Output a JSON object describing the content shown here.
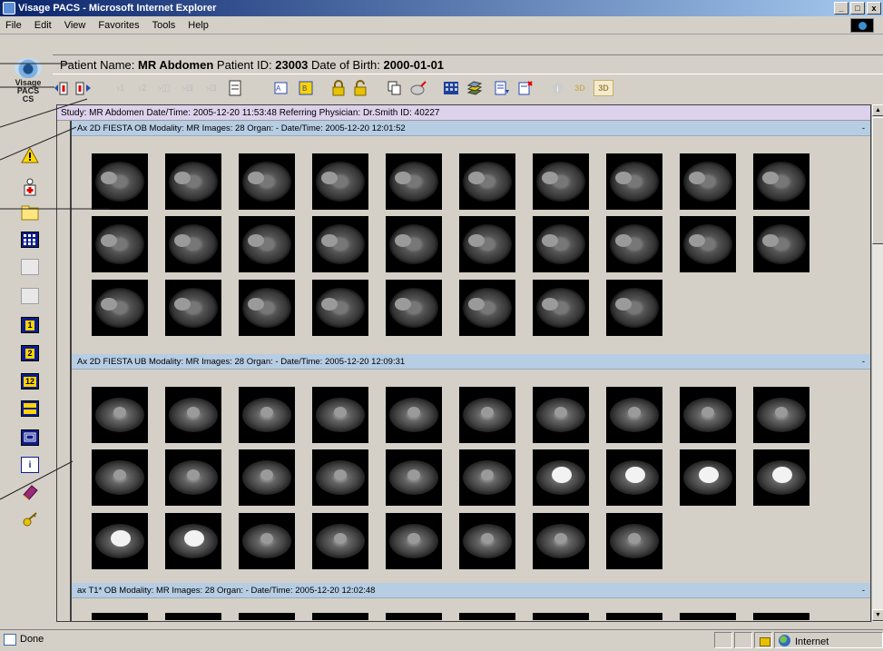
{
  "window": {
    "title": "Visage PACS - Microsoft Internet Explorer",
    "controls": [
      "_",
      "□",
      "x"
    ]
  },
  "menu": [
    "File",
    "Edit",
    "View",
    "Favorites",
    "Tools",
    "Help"
  ],
  "logo": {
    "line1": "Visage",
    "line2": "PACS",
    "line3": "CS"
  },
  "patient": {
    "name_label": "Patient Name:",
    "name": "MR Abdomen",
    "id_label": "Patient ID:",
    "id": "23003",
    "dob_label": "Date of Birth:",
    "dob": "2000-01-01"
  },
  "study": {
    "text": "Study:  MR Abdomen  Date/Time: 2005-12-20 11:53:48  Referring Physician: Dr.Smith  ID: 40227"
  },
  "series": [
    {
      "text": "Ax 2D FIESTA OB  Modality: MR  Images: 28  Organ: -  Date/Time: 2005-12-20 12:01:52",
      "collapse": "-"
    },
    {
      "text": "Ax 2D FIESTA UB  Modality: MR  Images: 28  Organ: -  Date/Time: 2005-12-20 12:09:31",
      "collapse": "-"
    },
    {
      "text": "ax T1* OB  Modality: MR  Images: 28  Organ: -  Date/Time: 2005-12-20 12:02:48",
      "collapse": "-"
    }
  ],
  "side_icons": [
    "warning-icon",
    "patient-icon",
    "folder-icon",
    "grid-layout-icon",
    "disabled-view-icon",
    "disabled-split-icon",
    "layout-1-icon",
    "layout-2-icon",
    "layout-1-2-icon",
    "layout-stack-icon",
    "window-icon",
    "info-icon",
    "book-icon",
    "key-icon"
  ],
  "side_labels": {
    "one": "1",
    "two": "2",
    "onetwo": "12",
    "info": "i"
  },
  "toolbar_icons": [
    "prev-patient-icon",
    "next-patient-icon",
    "step-1-icon",
    "step-2-icon",
    "layout-a-icon",
    "layout-b-icon",
    "layout-c-icon",
    "document-icon",
    "query-icon",
    "query-b-icon",
    "lock-icon",
    "unlock-icon",
    "copy-icon",
    "clear-icon",
    "grid-icon",
    "stack-icon",
    "export-icon",
    "delete-icon",
    "info-icon",
    "3d-icon",
    "3d-mpr-icon"
  ],
  "statusbar": {
    "status": "Done",
    "zone": "Internet"
  }
}
